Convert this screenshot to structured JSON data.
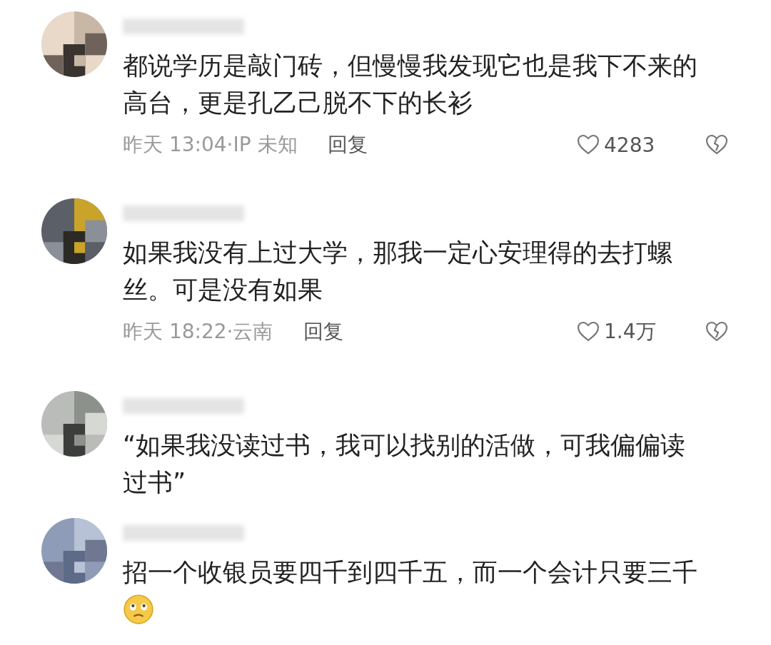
{
  "comments": [
    {
      "name": {
        "kind": "blurred"
      },
      "text": "都说学历是敲门砖，但慢慢我发现它也是我下不来的高台，更是孔乙己脱不下的长衫",
      "has_emoji": false,
      "meta": {
        "time": "昨天 13:04·IP 未知",
        "reply": "回复",
        "likes": "4283"
      }
    },
    {
      "name": {
        "kind": "blurred"
      },
      "text": "如果我没有上过大学，那我一定心安理得的去打螺丝。可是没有如果",
      "has_emoji": false,
      "meta": {
        "time": "昨天 18:22·云南",
        "reply": "回复",
        "likes": "1.4万"
      }
    },
    {
      "name": {
        "kind": "blurred"
      },
      "text": "“如果我没读过书，我可以找别的活做，可我偏偏读过书”",
      "has_emoji": false
    },
    {
      "name": {
        "kind": "blurred"
      },
      "text": "招一个收银员要四千到四千五，而一个会计只要三千",
      "has_emoji": true
    }
  ]
}
